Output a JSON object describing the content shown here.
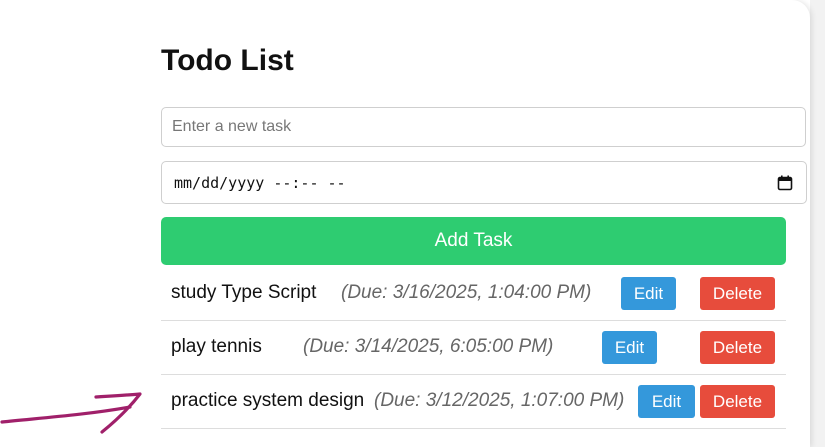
{
  "app": {
    "title": "Todo List"
  },
  "form": {
    "task_placeholder": "Enter a new task",
    "task_value": "",
    "date_placeholder": "mm/dd/yyyy --:-- --",
    "add_label": "Add Task"
  },
  "tasks": [
    {
      "name": "study Type Script",
      "due": "(Due: 3/16/2025, 1:04:00 PM)",
      "edit_label": "Edit",
      "delete_label": "Delete"
    },
    {
      "name": "play tennis",
      "due": "(Due: 3/14/2025, 6:05:00 PM)",
      "edit_label": "Edit",
      "delete_label": "Delete"
    },
    {
      "name": "practice system design",
      "due": "(Due: 3/12/2025, 1:07:00 PM)",
      "edit_label": "Edit",
      "delete_label": "Delete"
    }
  ],
  "colors": {
    "add_button": "#2ecc71",
    "edit_button": "#3498db",
    "delete_button": "#e74c3c",
    "annotation_arrow": "#a0206a"
  }
}
